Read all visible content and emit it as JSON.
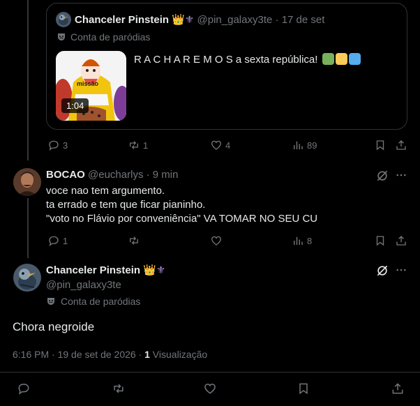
{
  "quoted": {
    "display_name": "Chanceler Pinstein",
    "emoji_crown": "👑",
    "emoji_fleur": "⚜",
    "handle": "@pin_galaxy3te",
    "sep": "·",
    "date": "17 de set",
    "parody_label": "Conta de paródias",
    "text": "R A C H A R E M O S a sexta república!",
    "video_duration": "1:04",
    "image_caption": "missão",
    "badge_colors": [
      "#78b159",
      "#fdcb58",
      "#55acee"
    ]
  },
  "quoted_actions": {
    "replies": "3",
    "reposts": "1",
    "likes": "4",
    "views": "89"
  },
  "reply": {
    "display_name": "BOCAO",
    "handle": "@eucharlys",
    "sep": "·",
    "time": "9 min",
    "lines": [
      "voce nao tem argumento.",
      "ta errado e tem que ficar pianinho.",
      "\"voto no Flávio por conveniência\" VA TOMAR NO SEU CU"
    ]
  },
  "reply_actions": {
    "replies": "1",
    "views": "8"
  },
  "main": {
    "display_name": "Chanceler Pinstein",
    "emoji_crown": "👑",
    "emoji_fleur": "⚜",
    "handle": "@pin_galaxy3te",
    "parody_label": "Conta de paródias",
    "text": "Chora negroide",
    "timestamp": "6:16 PM · 19 de set de 2026 · ",
    "views_count": "1",
    "views_label": " Visualização"
  },
  "colors": {
    "background": "#000000",
    "text": "#e7e9ea",
    "muted": "#71767b",
    "border": "#2f3336"
  }
}
